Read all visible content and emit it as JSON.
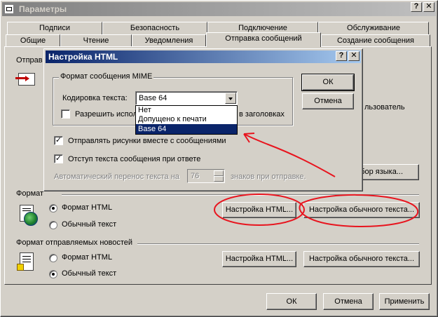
{
  "main_window": {
    "title": "Параметры",
    "tabs_row1": [
      "Подписи",
      "Безопасность",
      "Подключение",
      "Обслуживание"
    ],
    "tabs_row2": [
      "Общие",
      "Чтение",
      "Уведомления",
      "Отправка сообщений",
      "Создание сообщения"
    ],
    "send_format_label": "Отправ",
    "lang_btn_partial": "бор языка...",
    "user_partial": "льзователь",
    "mail_format": {
      "title": "Формат",
      "opt_html": "Формат HTML",
      "opt_plain": "Обычный текст",
      "selected": "Формат HTML",
      "btn_html": "Настройка HTML...",
      "btn_plain": "Настройка обычного текста..."
    },
    "news_format": {
      "title": "Формат отправляемых новостей",
      "opt_html": "Формат HTML",
      "opt_plain": "Обычный текст",
      "selected": "Обычный текст",
      "btn_html": "Настройка HTML...",
      "btn_plain": "Настройка обычного текста..."
    },
    "buttons": {
      "ok": "ОК",
      "cancel": "Отмена",
      "apply": "Применить"
    }
  },
  "dialog": {
    "title": "Настройка HTML",
    "mime_group_title": "Формат сообщения MIME",
    "encoding_label": "Кодировка текста:",
    "encoding_value": "Base 64",
    "encoding_options": [
      "Нет",
      "Допущено к печати",
      "Base 64"
    ],
    "encoding_highlighted": "Base 64",
    "allow_label_start": "Разрешить испол",
    "allow_label_end": "в заголовках",
    "send_pictures": "Отправлять рисунки вместе с сообщениями",
    "indent_text": "Отступ текста сообщения при ответе",
    "wrap_start": "Автоматический перенос текста на",
    "wrap_value": "76",
    "wrap_end": "знаков при отправке.",
    "ok": "ОК",
    "cancel": "Отмена",
    "help": "?",
    "close": "X"
  },
  "annotation_color": "#e8141e"
}
